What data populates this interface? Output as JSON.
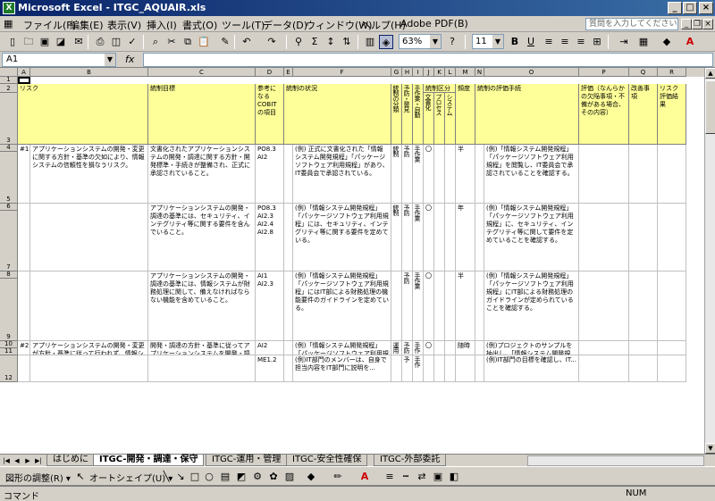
{
  "window": {
    "title": "Microsoft Excel - ITGC_AQUAIR.xls",
    "app_icon": "excel-icon",
    "min": "_",
    "max": "□",
    "close": "×"
  },
  "menu": {
    "items": [
      "ファイル(F)",
      "編集(E)",
      "表示(V)",
      "挿入(I)",
      "書式(O)",
      "ツール(T)",
      "データ(D)",
      "ウィンドウ(W)",
      "ヘルプ(H)",
      "Adobe PDF(B)"
    ],
    "help_placeholder": "質問を入力してください",
    "doc_min": "_",
    "doc_restore": "❐",
    "doc_close": "×"
  },
  "toolbar": {
    "zoom": "63%",
    "font_size": "11",
    "bold": "B",
    "underline": "U",
    "sigma": "Σ"
  },
  "formula": {
    "cell_ref": "A1",
    "fx": "fx",
    "value": ""
  },
  "columns": [
    "A",
    "B",
    "C",
    "D",
    "E",
    "F",
    "G",
    "H",
    "I",
    "J",
    "K",
    "L",
    "M",
    "N",
    "O",
    "P",
    "Q",
    "R"
  ],
  "rows": [
    "1",
    "2",
    "3",
    "4",
    "5",
    "6",
    "7",
    "8",
    "9",
    "10",
    "11",
    "12"
  ],
  "header": {
    "risk": "リスク",
    "control_objective": "統制目標",
    "cobit": "参考になるCOBITの項目",
    "control_activity": "統制の状況",
    "bunrui": "統制の分類",
    "bunrui_sub": "予防・発見",
    "yobo_label": "予防・発見",
    "shudo_label": "手作業・自動",
    "key_group": "統制区分",
    "key_a": "文書化",
    "key_b": "プロセス",
    "key_c": "システム",
    "frequency": "頻度",
    "test_procedure": "統制の評価手続",
    "notes": "評価（なんらかの欠陥事項・不備がある場合、その内容）",
    "improve": "改善事項",
    "risk_eval": "リスク評価結果"
  },
  "data_rows": [
    {
      "no": "#1",
      "risk": "アプリケーションシステムの開発・変更に関する方針・基準の欠如により、情報システムの信頼性を損なうリスク。",
      "objective": "文書化されたアプリケーションシステムの開発・調達に関する方針・開発標準・手続きが整備され、正式に承認されていること。",
      "cobit": "PO8.3\nAI2",
      "activity": "(例) 正式に文書化された「情報システム開発規程」「パッケージソフトウェア利用規程」があり、IT委員会で承認されている。",
      "cat": "統制",
      "prev": "予防",
      "manual": "手作業",
      "doc": "〇",
      "freq": "半",
      "test": "(例)「情報システム開発規程」「パッケージソフトウェア利用規程」を閲覧し、IT委員会で承認されていることを確認する。"
    },
    {
      "no": "",
      "risk": "",
      "objective": "アプリケーションシステムの開発・調達の基準には、セキュリティ、インテグリティ等に関する要件を含んでいること。",
      "cobit": "PO8.3\nAI2.3\nAI2.4\nAI2.8",
      "activity": "(例)「情報システム開発規程」「パッケージソフトウェア利用規程」には、セキュリティ、インテグリティ等に関する要件を定めている。",
      "cat": "統制",
      "prev": "予防",
      "manual": "手作業",
      "doc": "〇",
      "freq": "年",
      "test": "(例)「情報システム開発規程」「パッケージソフトウェア利用規程」に、セキュリティ、インテグリティ等に関して要件を定めていることを確認する。"
    },
    {
      "no": "",
      "risk": "",
      "objective": "アプリケーションシステムの開発・調達の基準には、情報システムが財務処理に関して、備えなければならない機能を含めていること。",
      "cobit": "AI1\nAI2.3",
      "activity": "(例)「情報システム開発規程」「パッケージソフトウェア利用規程」にはIT部による財務処理の機能要件のガイドラインを定めている。",
      "cat": "",
      "prev": "予防",
      "manual": "手作業",
      "doc": "〇",
      "freq": "半",
      "test": "(例)「情報システム開発規程」「パッケージソフトウェア利用規程」にIT部による財務処理のガイドラインが定められていることを確認する。"
    },
    {
      "no": "#2",
      "risk": "アプリケーションシステムの開発・変更が方針・基準に従って行われず、情報システムの信頼性を損なうリスク。",
      "objective": "開発・調達の方針・基準に従ってアプリケーションシステムを開発・調達していること。",
      "cobit": "AI2",
      "activity": "(例)「情報システム開発規程」「パッケージソフトウェア利用規程」に従って、アプリケーションシステムの開発・調達を行っている。",
      "cat": "運用",
      "prev": "予防",
      "manual": "手作業",
      "doc": "〇",
      "freq": "随時",
      "test": "(例)プロジェクトのサンプルを抽出し、「情報システム開発規程」「パッケージソフトウェア利用規程」に従って、アプリケーションシステムの開発・調達が行われ、完成したかを確かめる。"
    },
    {
      "no": "",
      "risk": "",
      "objective": "",
      "cobit": "ME1.2",
      "activity": "(例)IT部門のメンバーは、自身で担当内容をIT部門に説明を...",
      "cat": "",
      "prev": "予",
      "manual": "手作",
      "doc": "",
      "freq": "",
      "test": "(例)IT部門の目標を確認し、IT..."
    }
  ],
  "tabs": {
    "first": "|◀",
    "prev": "◀",
    "next": "▶",
    "last": "▶|",
    "items": [
      "はじめに",
      "ITGC-開発・調達・保守",
      "ITGC-運用・管理",
      "ITGC-安全性確保",
      "ITGC-外部委託"
    ]
  },
  "draw": {
    "adjust": "図形の調整(R) ▾",
    "autoshape": "オートシェイプ(U) ▾"
  },
  "status": {
    "mode": "コマンド",
    "num": "NUM"
  }
}
